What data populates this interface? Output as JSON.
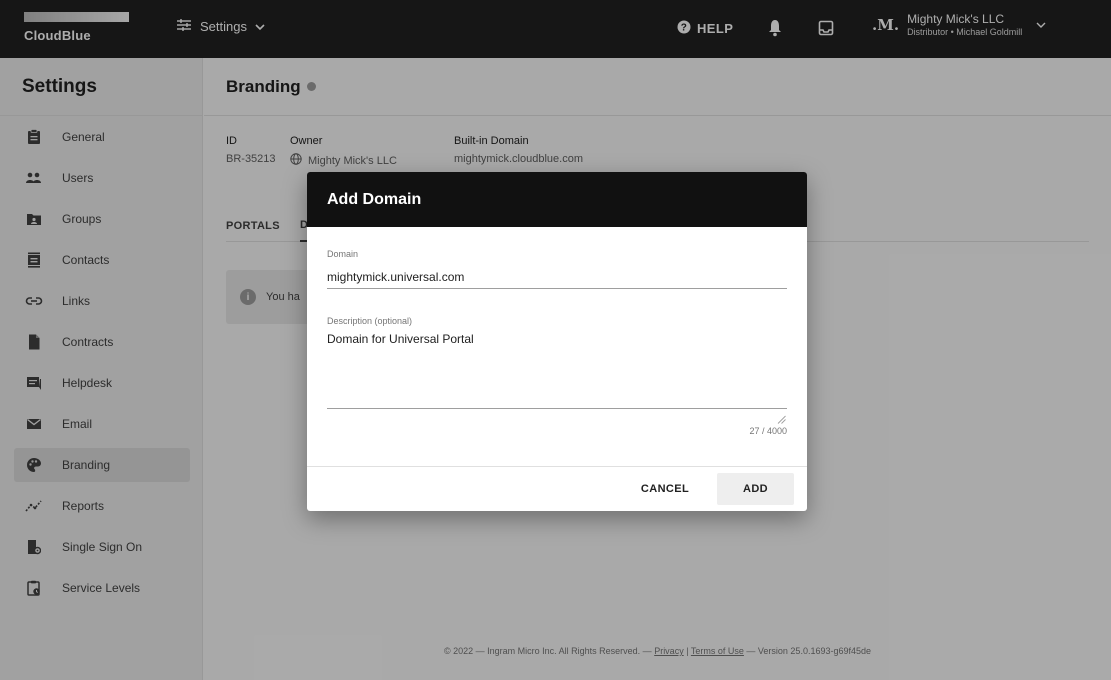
{
  "topbar": {
    "logo_text": "CloudBlue",
    "settings_label": "Settings",
    "help_label": "HELP",
    "account_name": "Mighty Mick's LLC",
    "account_sub": "Distributor • Michael Goldmill",
    "account_logo": ".M."
  },
  "sidebar": {
    "title": "Settings",
    "items": [
      {
        "label": "General",
        "icon": "clipboard-icon"
      },
      {
        "label": "Users",
        "icon": "users-icon"
      },
      {
        "label": "Groups",
        "icon": "groups-icon"
      },
      {
        "label": "Contacts",
        "icon": "contacts-icon"
      },
      {
        "label": "Links",
        "icon": "link-icon"
      },
      {
        "label": "Contracts",
        "icon": "document-icon"
      },
      {
        "label": "Helpdesk",
        "icon": "helpdesk-icon"
      },
      {
        "label": "Email",
        "icon": "email-icon"
      },
      {
        "label": "Branding",
        "icon": "palette-icon",
        "active": true
      },
      {
        "label": "Reports",
        "icon": "reports-icon"
      },
      {
        "label": "Single Sign On",
        "icon": "sso-icon"
      },
      {
        "label": "Service Levels",
        "icon": "service-levels-icon"
      }
    ]
  },
  "main": {
    "title": "Branding",
    "fields": {
      "id_label": "ID",
      "id_value": "BR-35213",
      "owner_label": "Owner",
      "owner_value": "Mighty Mick's LLC",
      "domain_label": "Built-in Domain",
      "domain_value": "mightymick.cloudblue.com"
    },
    "tabs": [
      "PORTALS",
      "D"
    ],
    "notice_text": "You ha",
    "footer": {
      "prefix": "© 2022 — Ingram Micro Inc. All Rights Reserved. — ",
      "privacy": "Privacy",
      "sep": " | ",
      "terms": "Terms of Use",
      "version": " — Version 25.0.1693-g69f45de"
    }
  },
  "dialog": {
    "title": "Add Domain",
    "domain_label": "Domain",
    "domain_value": "mightymick.universal.com",
    "description_label": "Description (optional)",
    "description_value": "Domain for Universal Portal",
    "counter": "27 / 4000",
    "cancel_label": "CANCEL",
    "add_label": "ADD"
  },
  "colors": {
    "topbar": "#212121",
    "dialog_header": "#111111",
    "sidebar": "#eeeeee",
    "overlay": "rgba(0,0,0,0.32)"
  }
}
